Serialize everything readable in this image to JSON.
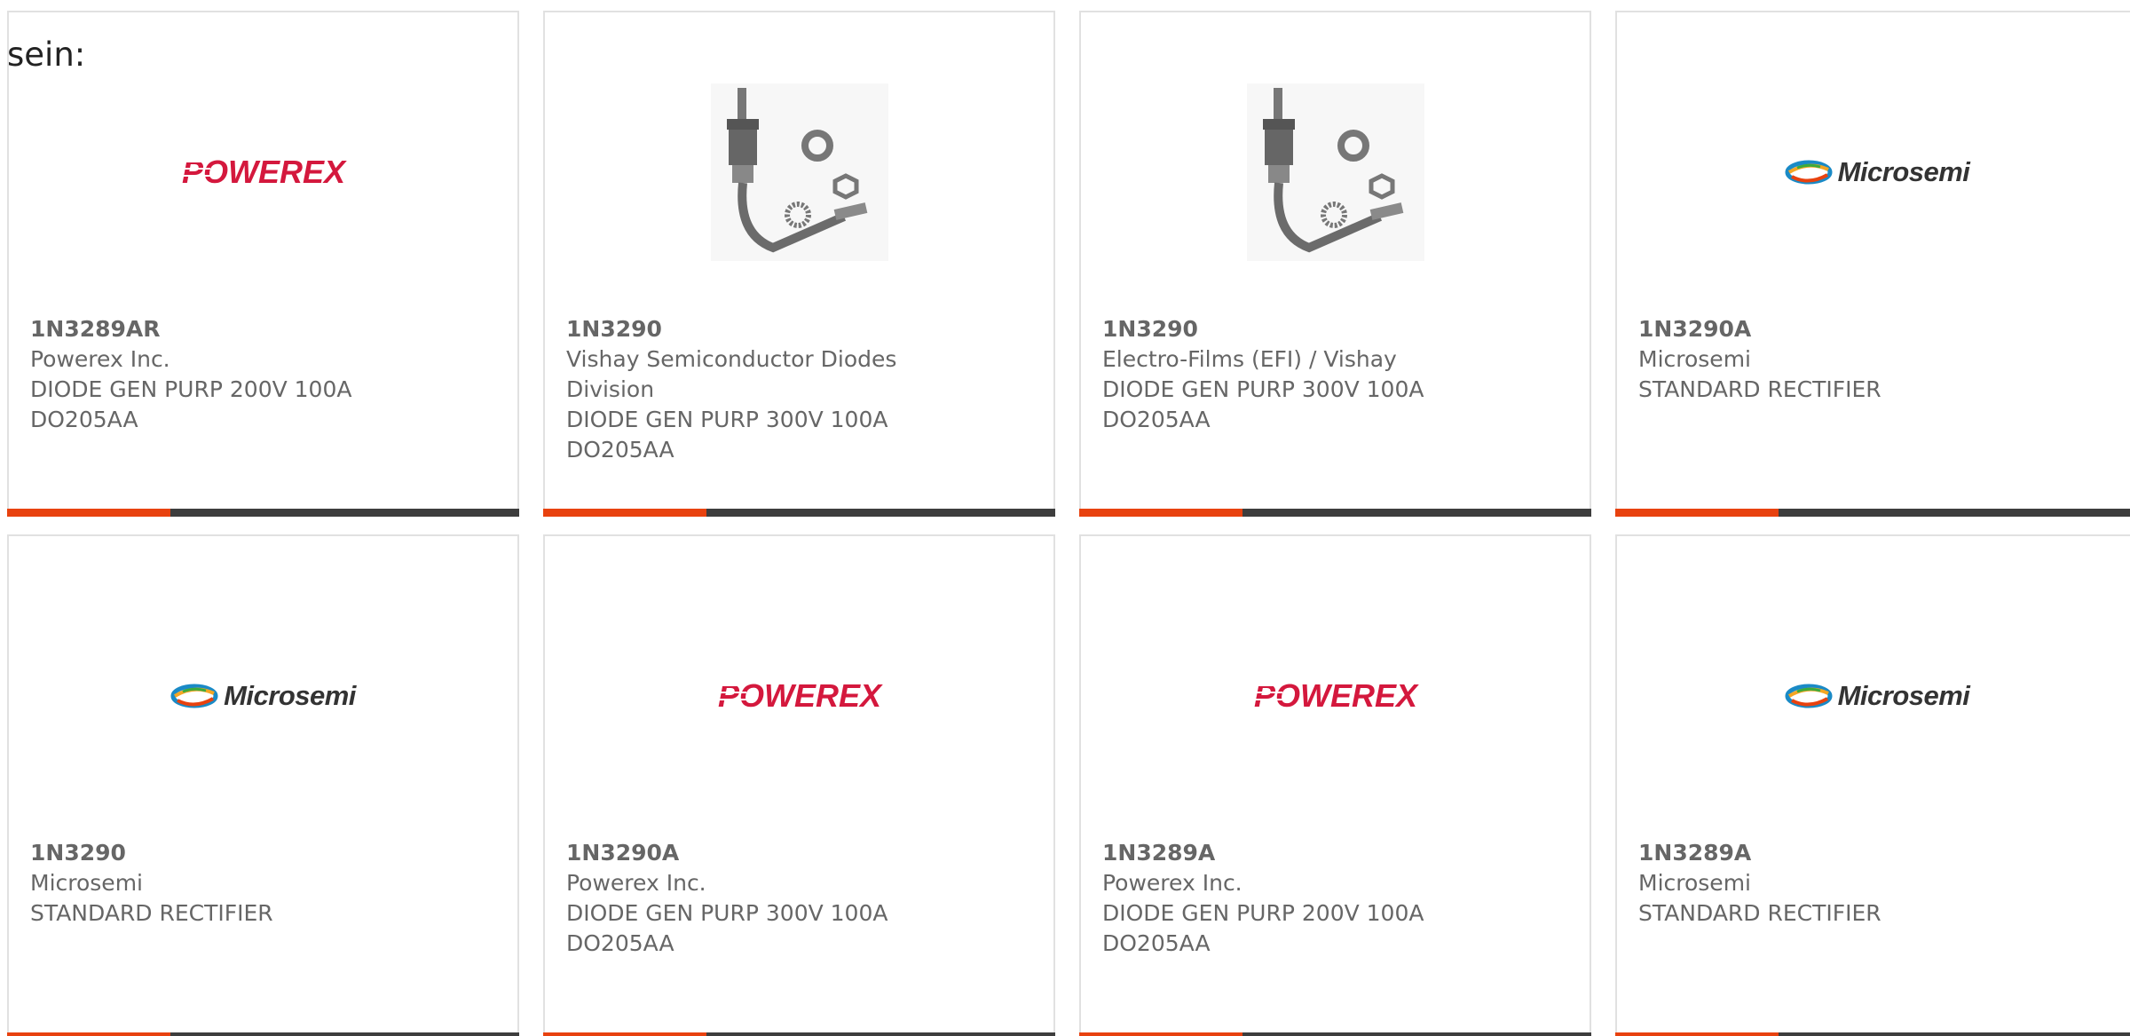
{
  "intro": {
    "text": "sein:"
  },
  "colors": {
    "accent": "#e8420f",
    "bar": "#3d3d3d",
    "border": "#e1e1e1",
    "text": "#666666",
    "powerex": "#d4183d"
  },
  "products": [
    {
      "part": "1N3289AR",
      "manufacturer": "Powerex Inc.",
      "description": "DIODE GEN PURP 200V 100A",
      "package": "DO205AA",
      "image": "powerex-logo"
    },
    {
      "part": "1N3290",
      "manufacturer": "Vishay Semiconductor Diodes",
      "manufacturer_cont": "Division",
      "description": "DIODE GEN PURP 300V 100A",
      "package": "DO205AA",
      "image": "stud-diode-photo"
    },
    {
      "part": "1N3290",
      "manufacturer": "Electro-Films (EFI) / Vishay",
      "description": "DIODE GEN PURP 300V 100A",
      "package": "DO205AA",
      "image": "stud-diode-photo"
    },
    {
      "part": "1N3290A",
      "manufacturer": "Microsemi",
      "description": "STANDARD RECTIFIER",
      "image": "microsemi-logo"
    },
    {
      "part": "1N3290",
      "manufacturer": "Microsemi",
      "description": "STANDARD RECTIFIER",
      "image": "microsemi-logo"
    },
    {
      "part": "1N3290A",
      "manufacturer": "Powerex Inc.",
      "description": "DIODE GEN PURP 300V 100A",
      "package": "DO205AA",
      "image": "powerex-logo"
    },
    {
      "part": "1N3289A",
      "manufacturer": "Powerex Inc.",
      "description": "DIODE GEN PURP 200V 100A",
      "package": "DO205AA",
      "image": "powerex-logo"
    },
    {
      "part": "1N3289A",
      "manufacturer": "Microsemi",
      "description": "STANDARD RECTIFIER",
      "image": "microsemi-logo"
    }
  ],
  "logos": {
    "powerex": "POWEREX",
    "microsemi": "Microsemi"
  }
}
